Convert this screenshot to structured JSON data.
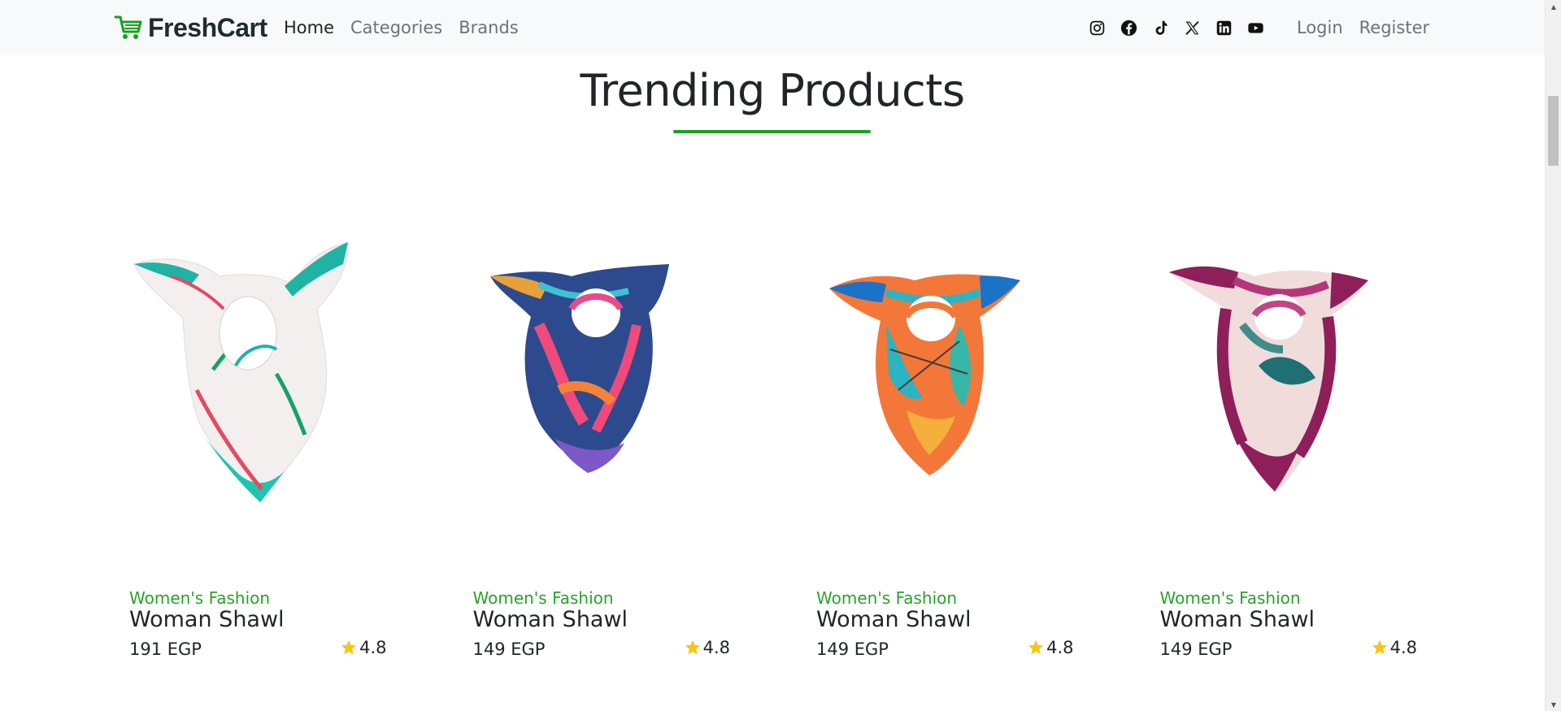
{
  "brand": {
    "name": "FreshCart",
    "icon": "cart-icon",
    "accent": "#16a31c"
  },
  "nav": {
    "links": [
      "Home",
      "Categories",
      "Brands"
    ],
    "active": "Home"
  },
  "socials": [
    "instagram-icon",
    "facebook-icon",
    "tiktok-icon",
    "x-icon",
    "linkedin-icon",
    "youtube-icon"
  ],
  "auth": {
    "login": "Login",
    "register": "Register"
  },
  "section": {
    "title": "Trending Products"
  },
  "products": [
    {
      "category": "Women's Fashion",
      "name": "Woman Shawl",
      "price": "191 EGP",
      "rating": "4.8"
    },
    {
      "category": "Women's Fashion",
      "name": "Woman Shawl",
      "price": "149 EGP",
      "rating": "4.8"
    },
    {
      "category": "Women's Fashion",
      "name": "Woman Shawl",
      "price": "149 EGP",
      "rating": "4.8"
    },
    {
      "category": "Women's Fashion",
      "name": "Woman Shawl",
      "price": "149 EGP",
      "rating": "4.8"
    }
  ],
  "colors": {
    "category": "#29a329",
    "star": "#f5c518",
    "navbar_bg": "#f8f9fa"
  }
}
